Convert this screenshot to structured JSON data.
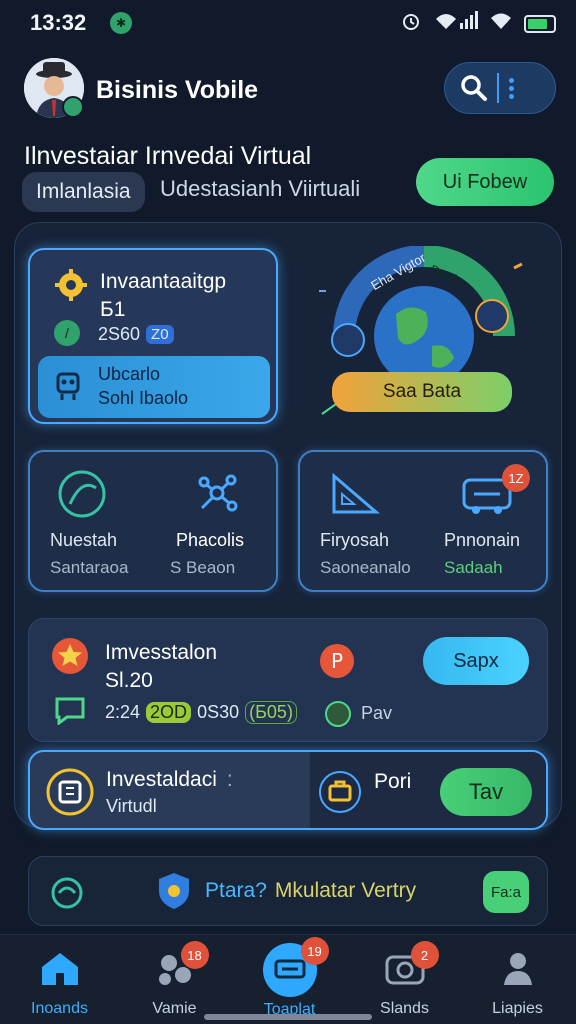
{
  "status_bar": {
    "time": "13:32"
  },
  "header": {
    "app_title": "Bisinis Vobile",
    "headline": "Ilnvestaiar Irnvedai Virtual",
    "chip_label": "Imlanlasia",
    "subline": "Udestasianh Viirtuali",
    "action_button": "Ui Fobew"
  },
  "card_invest": {
    "title": "Invaantaaitgp",
    "sub": "Б1",
    "value": "2S60",
    "badge": "Z0",
    "inner_line1": "Ubcarlo",
    "inner_line2": "Sohl Ibaolo"
  },
  "globe": {
    "arc_text": "Eha Vigtor",
    "arc_badge": "Daat",
    "button": "Saa Bata"
  },
  "grid": [
    {
      "title": "Nuestah",
      "sub": "Santaraoa"
    },
    {
      "title": "Phacolis",
      "sub": "S Beaon"
    },
    {
      "title": "Firyosah",
      "sub": "Saoneanalo"
    },
    {
      "title": "Pnnonain",
      "sub": "Sadaah",
      "badge": "1Z"
    }
  ],
  "row_stats": {
    "title": "Imvesstalon",
    "value": "Sl.20",
    "stat1": "2:24",
    "stat2": "2OD",
    "stat3": "0S30",
    "stat4": "(Б05)",
    "pav": "Pav",
    "button": "Sapx"
  },
  "row_virtual": {
    "line1": "Investaldaci",
    "line1_suffix": ":",
    "line2": "Virtudl",
    "pori": "Pori",
    "button": "Tav"
  },
  "banner": {
    "text_a": "Ptara?",
    "text_b": "Mkulatar Vertry",
    "right_label": "Fa:a"
  },
  "nav": [
    {
      "label": "Inoands",
      "active": true
    },
    {
      "label": "Vamie",
      "badge": "18"
    },
    {
      "label": "Toaplat",
      "badge": "19",
      "center": true
    },
    {
      "label": "Slands",
      "badge": "2"
    },
    {
      "label": "Liapies"
    }
  ],
  "colors": {
    "background": "#111a2a",
    "accent_blue": "#4aa8ff",
    "accent_green": "#48cf78",
    "accent_orange": "#f2a23a",
    "badge_red": "#e0513a"
  }
}
